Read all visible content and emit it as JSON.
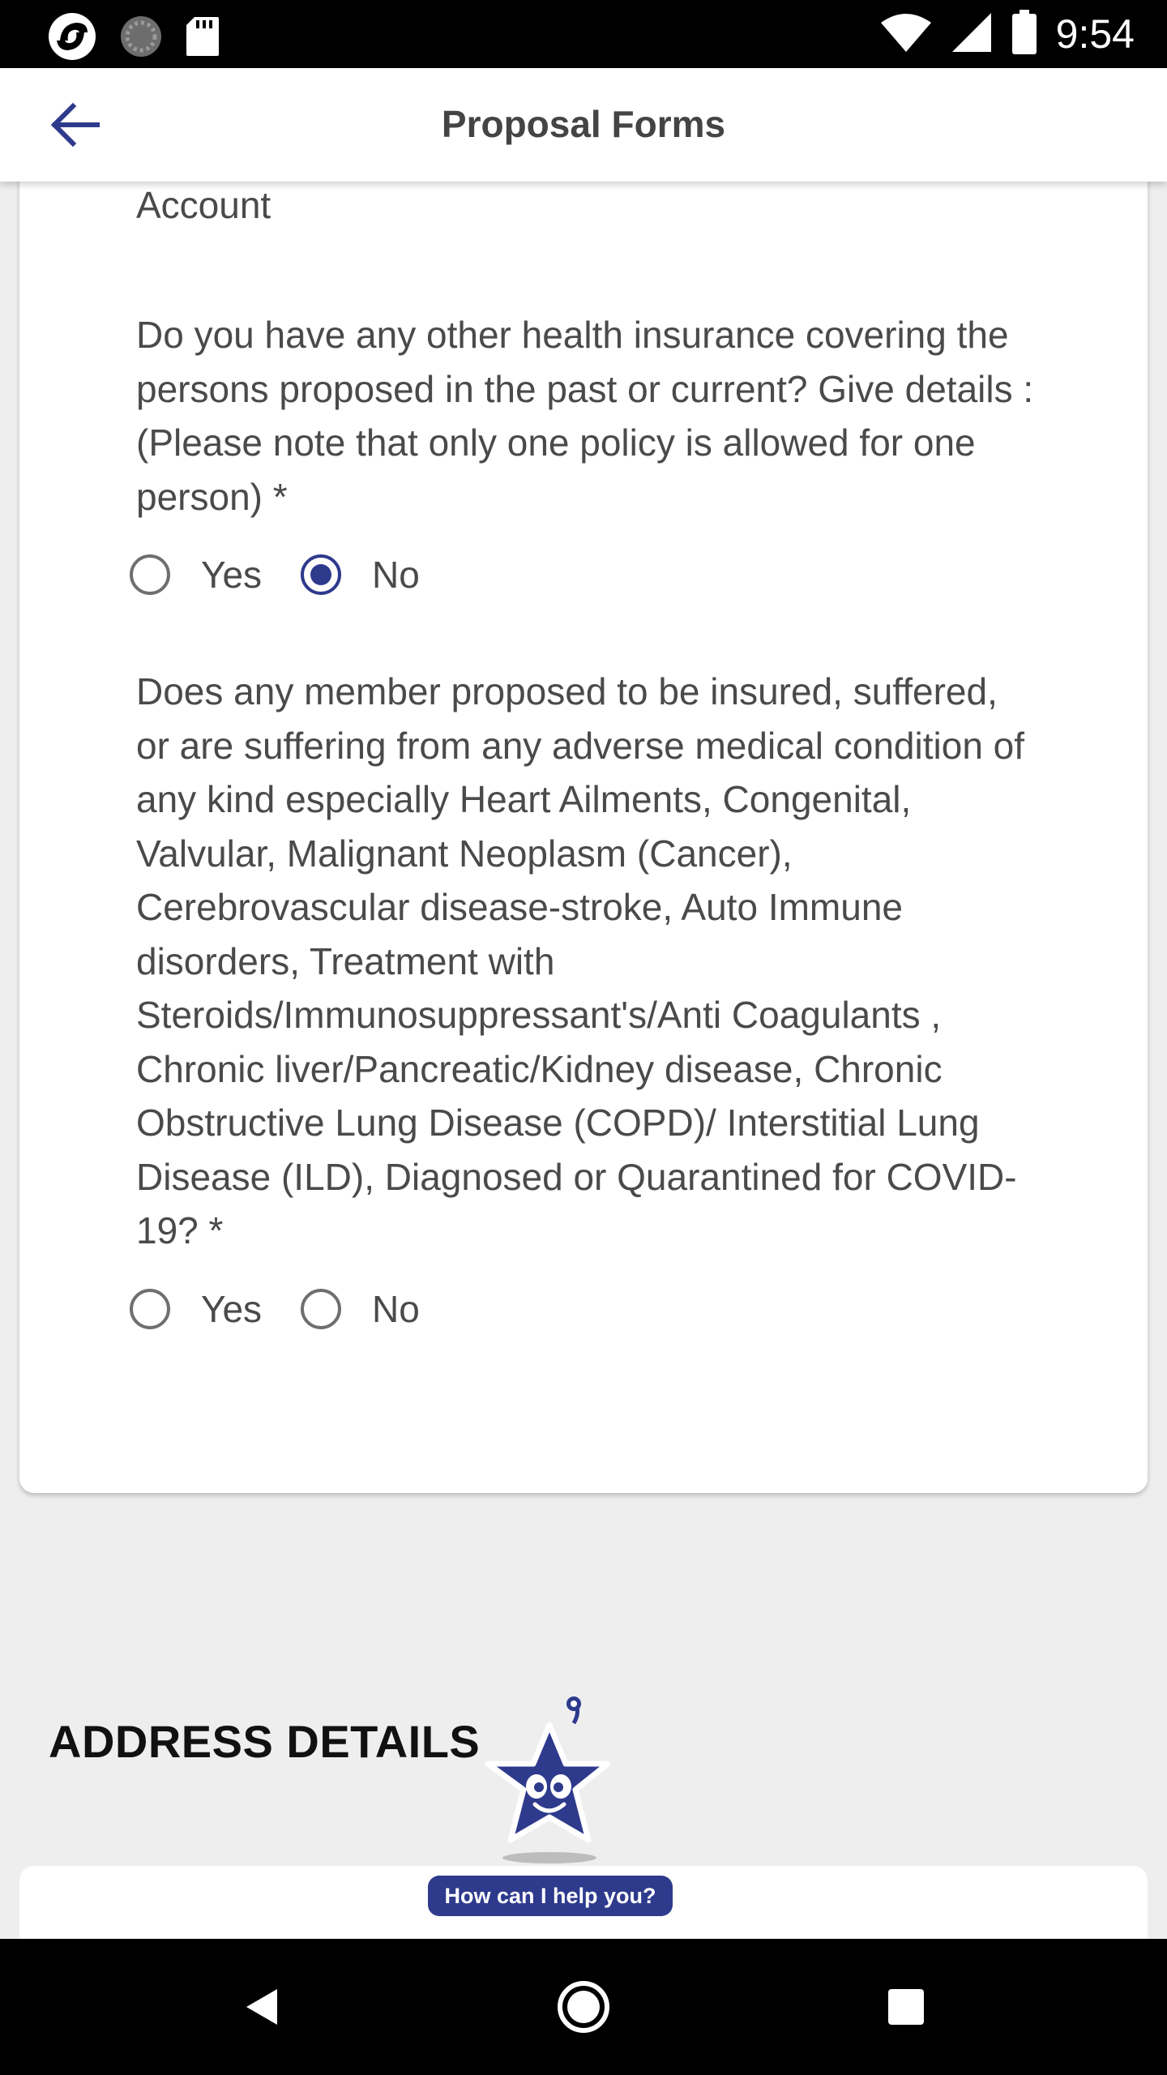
{
  "status_bar": {
    "time": "9:54",
    "left_icons": [
      "app-logo-icon",
      "loading-icon",
      "sd-card-icon"
    ],
    "right_icons": [
      "wifi-icon",
      "signal-icon",
      "battery-icon"
    ]
  },
  "app_bar": {
    "title": "Proposal Forms",
    "back_icon": "arrow-left-icon"
  },
  "form": {
    "partial_label": "Account",
    "questions": [
      {
        "text": "Do you have any other health insurance covering the persons proposed in the past or current? Give details : (Please note that only one policy is allowed for one person)  *",
        "options": [
          {
            "label": "Yes",
            "checked": false
          },
          {
            "label": "No",
            "checked": true
          }
        ]
      },
      {
        "text": "Does any member proposed to be insured, suffered, or are suffering from any adverse medical condition of any kind especially Heart Ailments, Congenital, Valvular, Malignant Neoplasm (Cancer), Cerebrovascular disease-stroke, Auto Immune disorders, Treatment with Steroids/Immunosuppressant's/Anti Coagulants , Chronic liver/Pancreatic/Kidney disease, Chronic Obstructive Lung Disease (COPD)/ Interstitial Lung Disease (ILD), Diagnosed or Quarantined for COVID-19?  *",
        "options": [
          {
            "label": "Yes",
            "checked": false
          },
          {
            "label": "No",
            "checked": false
          }
        ]
      }
    ]
  },
  "address_section": {
    "title": "ADDRESS DETAILS"
  },
  "chatbot": {
    "bubble_text": "How can I help you?",
    "icon": "star-mascot-icon"
  },
  "nav_bar": {
    "icons": [
      "back-triangle-icon",
      "home-circle-icon",
      "recents-square-icon"
    ]
  },
  "colors": {
    "accent": "#2e3a8c",
    "background": "#eeeeef",
    "card": "#ffffff",
    "text": "#4a4a4a"
  }
}
